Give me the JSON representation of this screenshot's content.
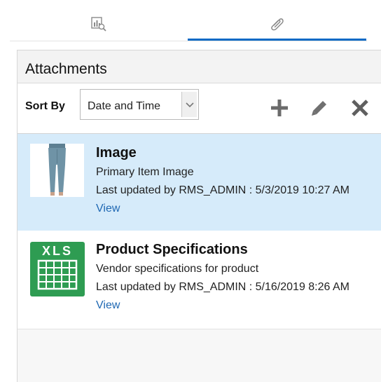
{
  "tabs": [
    {
      "icon": "report-search-icon",
      "selected": false
    },
    {
      "icon": "paperclip-icon",
      "selected": true
    }
  ],
  "panel": {
    "title": "Attachments"
  },
  "toolbar": {
    "sort_label": "Sort By",
    "sort_value": "Date and Time",
    "add_icon": "plus-icon",
    "edit_icon": "pencil-icon",
    "delete_icon": "close-icon"
  },
  "attachments": [
    {
      "title": "Image",
      "description": "Primary Item Image",
      "meta": "Last updated by RMS_ADMIN : 5/3/2019 10:27 AM",
      "link": "View",
      "thumbnail": "jeans-photo",
      "selected": true
    },
    {
      "title": "Product Specifications",
      "description": "Vendor specifications for product",
      "meta": "Last updated by RMS_ADMIN : 5/16/2019 8:26 AM",
      "link": "View",
      "thumbnail": "xls-file-icon",
      "xls_label": "XLS",
      "selected": false
    }
  ],
  "colors": {
    "accent": "#0b6ac5",
    "selected_row": "#d6ebfa",
    "link": "#1f68b3",
    "xls_green": "#2e9c52"
  }
}
